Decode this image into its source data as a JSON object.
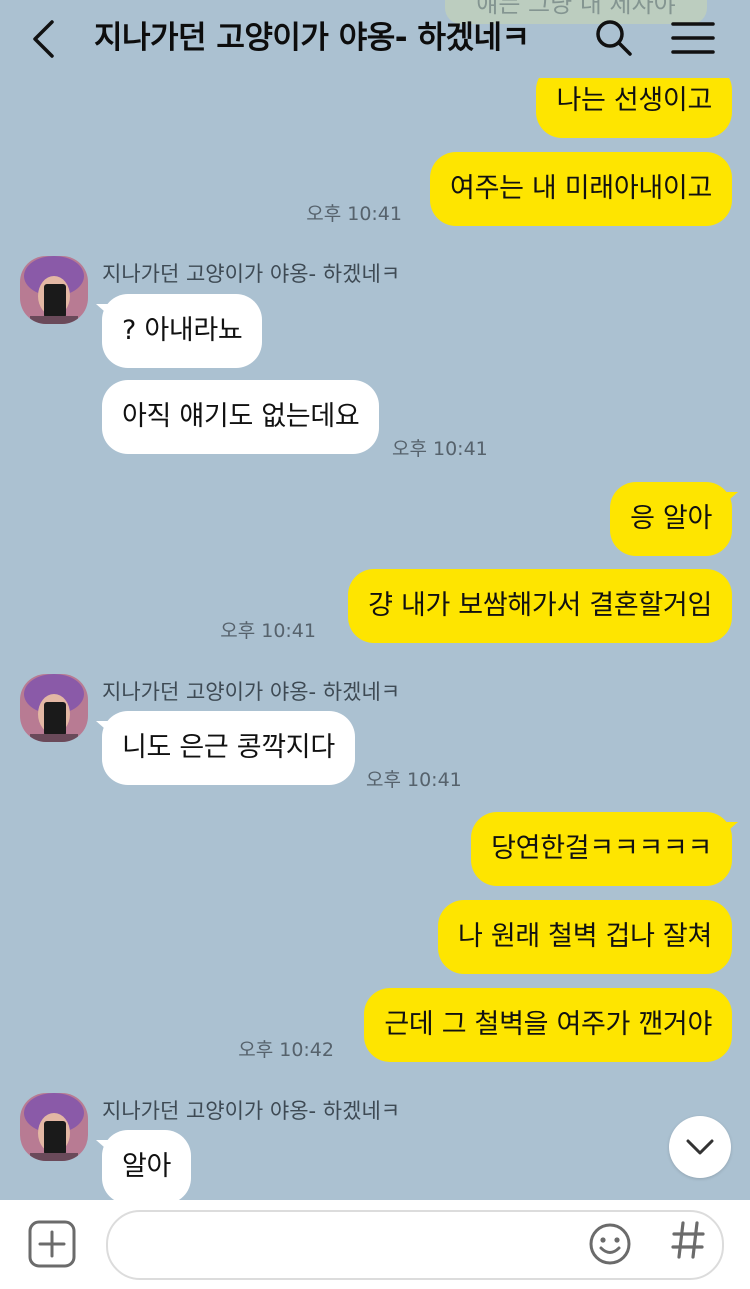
{
  "header": {
    "title": "지나가던 고양이가 야옹- 하겠네ㅋ",
    "ghost_text": "얘는 그냥 내 제자야"
  },
  "messages": [
    {
      "from": "me",
      "text": "나는 선생이고"
    },
    {
      "from": "me",
      "text": "여주는 내 미래아내이고",
      "time": "오후 10:41"
    },
    {
      "from": "them",
      "sender": "지나가던 고양이가 야옹- 하겠네ㅋ",
      "text": "? 아내라뇨"
    },
    {
      "from": "them",
      "text": "아직 얘기도 없는데요",
      "time": "오후 10:41"
    },
    {
      "from": "me",
      "text": "응 알아"
    },
    {
      "from": "me",
      "text": "걍 내가 보쌈해가서 결혼할거임",
      "time": "오후 10:41"
    },
    {
      "from": "them",
      "sender": "지나가던 고양이가 야옹- 하겠네ㅋ",
      "text": "니도 은근 콩깍지다",
      "time": "오후 10:41"
    },
    {
      "from": "me",
      "text": "당연한걸ㅋㅋㅋㅋㅋ"
    },
    {
      "from": "me",
      "text": "나 원래 철벽 겁나 잘쳐"
    },
    {
      "from": "me",
      "text": "근데 그 철벽을 여주가 깬거야",
      "time": "오후 10:42"
    },
    {
      "from": "them",
      "sender": "지나가던 고양이가 야옹- 하겠네ㅋ",
      "text": "알아"
    }
  ],
  "input": {
    "placeholder": "",
    "value": ""
  },
  "icons": {
    "back": "chevron-left-icon",
    "search": "search-icon",
    "menu": "hamburger-menu-icon",
    "scroll": "chevron-down-icon",
    "plus": "plus-square-icon",
    "emoji": "smiley-icon",
    "hash": "hash-icon"
  },
  "colors": {
    "background": "#abc1d1",
    "my_bubble": "#fee500",
    "their_bubble": "#ffffff"
  }
}
